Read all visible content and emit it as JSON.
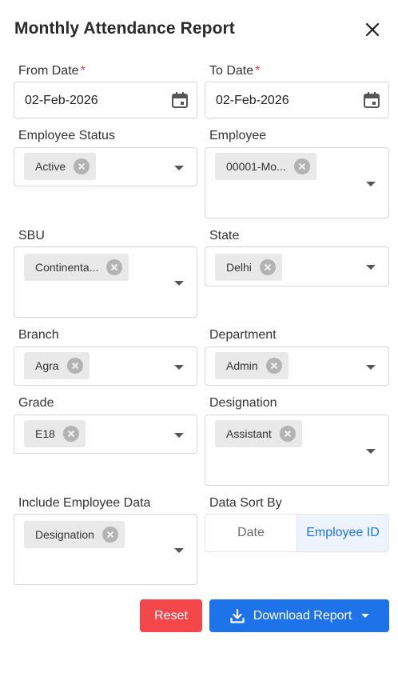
{
  "dialog": {
    "title": "Monthly Attendance Report"
  },
  "from_date": {
    "label": "From Date",
    "required_mark": "*",
    "value": "02-Feb-2026"
  },
  "to_date": {
    "label": "To Date",
    "required_mark": "*",
    "value": "02-Feb-2026"
  },
  "employee_status": {
    "label": "Employee Status",
    "chip": "Active"
  },
  "employee": {
    "label": "Employee",
    "chip": "00001-Mo..."
  },
  "sbu": {
    "label": "SBU",
    "chip": "Continenta..."
  },
  "state": {
    "label": "State",
    "chip": "Delhi"
  },
  "branch": {
    "label": "Branch",
    "chip": "Agra"
  },
  "department": {
    "label": "Department",
    "chip": "Admin"
  },
  "grade": {
    "label": "Grade",
    "chip": "E18"
  },
  "designation": {
    "label": "Designation",
    "chip": "Assistant"
  },
  "include_employee_data": {
    "label": "Include Employee Data",
    "chip": "Designation"
  },
  "data_sort_by": {
    "label": "Data Sort By",
    "options": [
      "Date",
      "Employee ID"
    ],
    "selected": "Employee ID"
  },
  "actions": {
    "reset_label": "Reset",
    "download_label": "Download Report"
  },
  "colors": {
    "primary": "#1e73e8",
    "danger": "#f4474b",
    "chip_bg": "#e9e9e9",
    "required": "#e53935"
  },
  "icons": {
    "close": "close-icon",
    "calendar": "calendar-icon",
    "chip_remove": "remove-circle-icon",
    "dropdown": "chevron-down-icon",
    "download": "download-icon"
  }
}
